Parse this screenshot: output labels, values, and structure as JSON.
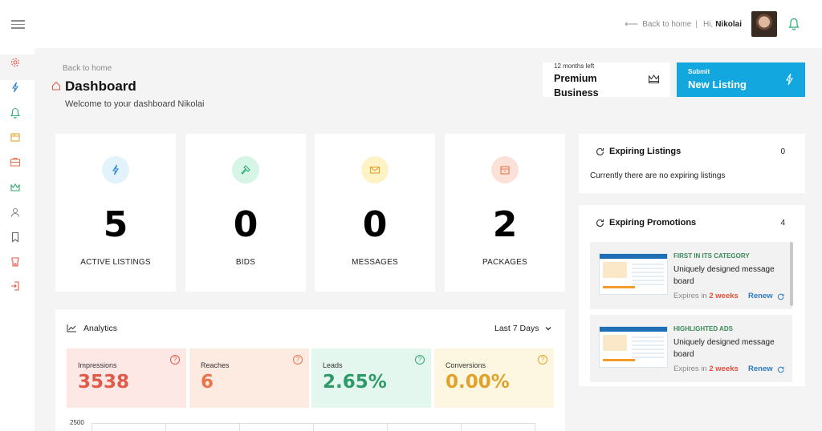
{
  "topbar": {
    "back_to_home": "Back to home",
    "separator": "|",
    "greeting": "Hi,",
    "user_name": "Nikolai"
  },
  "header": {
    "back_link": "Back to home",
    "title": "Dashboard",
    "welcome": "Welcome to your dashboard Nikolai"
  },
  "plan": {
    "remaining": "12 months left",
    "name": "Premium Business"
  },
  "submit": {
    "small_label": "Submit",
    "big_label": "New Listing"
  },
  "stats": [
    {
      "value": "5",
      "label": "ACTIVE LISTINGS",
      "icon": "bolt-icon",
      "color": "#e3f3fb"
    },
    {
      "value": "0",
      "label": "BIDS",
      "icon": "hammer-icon",
      "color": "#d6f5e6"
    },
    {
      "value": "0",
      "label": "MESSAGES",
      "icon": "envelope-icon",
      "color": "#fdf3c6"
    },
    {
      "value": "2",
      "label": "PACKAGES",
      "icon": "package-icon",
      "color": "#fbe1d8"
    }
  ],
  "analytics": {
    "title": "Analytics",
    "range": "Last 7 Days",
    "metrics": [
      {
        "label": "Impressions",
        "value": "3538",
        "bg": "#fde8e6",
        "color": "#e05a4a"
      },
      {
        "label": "Reaches",
        "value": "6",
        "bg": "#fdebe2",
        "color": "#e8764a"
      },
      {
        "label": "Leads",
        "value": "2.65%",
        "bg": "#e4f7ee",
        "color": "#2e9a68"
      },
      {
        "label": "Conversions",
        "value": "0.00%",
        "bg": "#fdf7e2",
        "color": "#e0a22a"
      }
    ],
    "y_tick": "2500"
  },
  "expiring_listings": {
    "title": "Expiring Listings",
    "count": "0",
    "empty_text": "Currently there are no expiring listings"
  },
  "expiring_promotions": {
    "title": "Expiring Promotions",
    "count": "4",
    "items": [
      {
        "category": "FIRST IN ITS CATEGORY",
        "text": "Uniquely designed message board",
        "expires_prefix": "Expires in",
        "expires": "2 weeks",
        "renew": "Renew"
      },
      {
        "category": "HIGHLIGHTED ADS",
        "text": "Uniquely designed message board",
        "expires_prefix": "Expires in",
        "expires": "2 weeks",
        "renew": "Renew"
      }
    ]
  },
  "sidebar_icons": [
    "gear-icon",
    "bolt-icon",
    "bell-icon",
    "package-icon",
    "briefcase-icon",
    "crown-icon",
    "user-icon",
    "bookmark-icon",
    "storefront-icon",
    "logout-icon"
  ]
}
